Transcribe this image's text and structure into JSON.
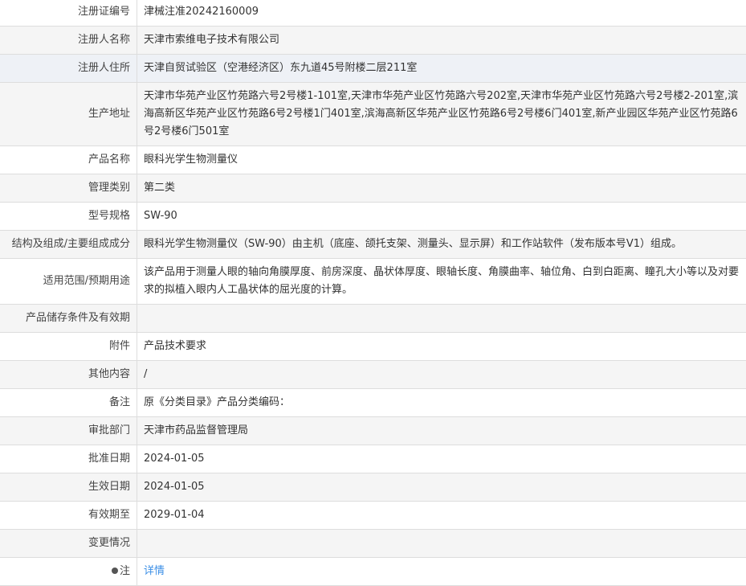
{
  "rows": [
    {
      "label": "注册证编号",
      "value": "津械注准20242160009"
    },
    {
      "label": "注册人名称",
      "value": "天津市索维电子技术有限公司"
    },
    {
      "label": "注册人住所",
      "value": "天津自贸试验区（空港经济区）东九道45号附楼二层211室"
    },
    {
      "label": "生产地址",
      "value": "天津市华苑产业区竹苑路六号2号楼1-101室,天津市华苑产业区竹苑路六号202室,天津市华苑产业区竹苑路六号2号楼2-201室,滨海高新区华苑产业区竹苑路6号2号楼1门401室,滨海高新区华苑产业区竹苑路6号2号楼6门401室,新产业园区华苑产业区竹苑路6号2号楼6门501室"
    },
    {
      "label": "产品名称",
      "value": "眼科光学生物测量仪"
    },
    {
      "label": "管理类别",
      "value": "第二类"
    },
    {
      "label": "型号规格",
      "value": "SW-90"
    },
    {
      "label": "结构及组成/主要组成成分",
      "value": "眼科光学生物测量仪（SW-90）由主机（底座、颌托支架、测量头、显示屏）和工作站软件（发布版本号V1）组成。"
    },
    {
      "label": "适用范围/预期用途",
      "value": "该产品用于测量人眼的轴向角膜厚度、前房深度、晶状体厚度、眼轴长度、角膜曲率、轴位角、白到白距离、瞳孔大小等以及对要求的拟植入眼内人工晶状体的屈光度的计算。"
    },
    {
      "label": "产品储存条件及有效期",
      "value": ""
    },
    {
      "label": "附件",
      "value": "产品技术要求"
    },
    {
      "label": "其他内容",
      "value": "/"
    },
    {
      "label": "备注",
      "value": "原《分类目录》产品分类编码："
    },
    {
      "label": "审批部门",
      "value": "天津市药品监督管理局"
    },
    {
      "label": "批准日期",
      "value": "2024-01-05"
    },
    {
      "label": "生效日期",
      "value": "2024-01-05"
    },
    {
      "label": "有效期至",
      "value": "2029-01-04"
    },
    {
      "label": "变更情况",
      "value": ""
    }
  ],
  "note": {
    "label": "注",
    "link": "详情"
  }
}
